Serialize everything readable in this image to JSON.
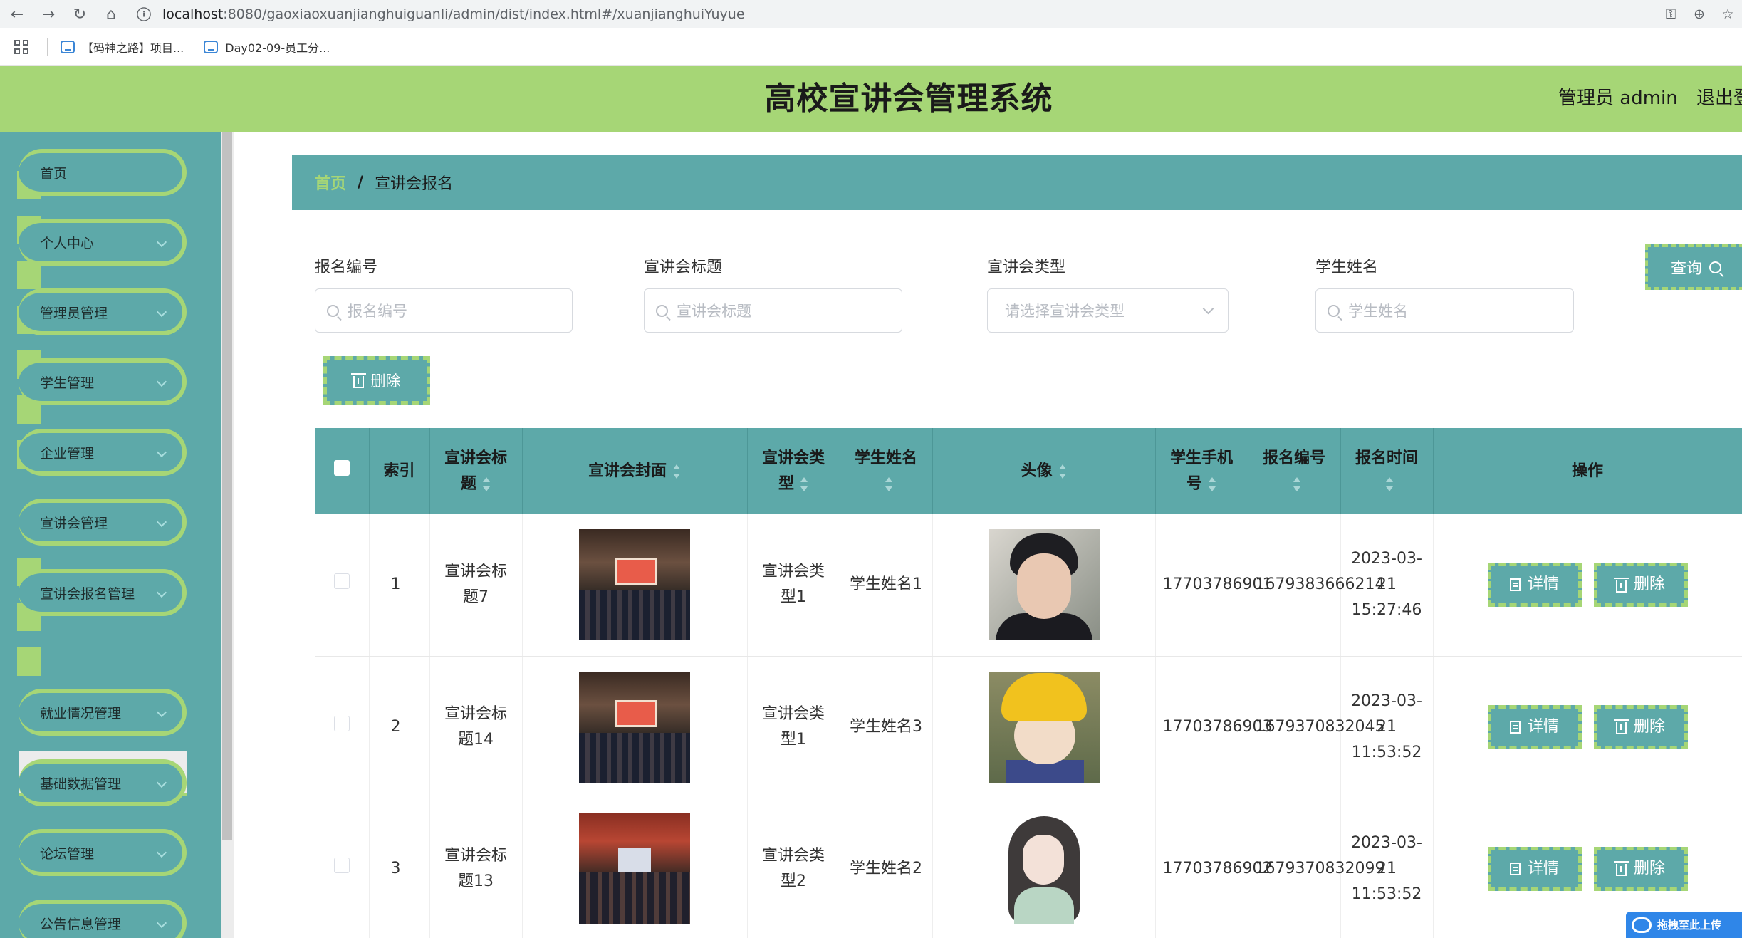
{
  "browser": {
    "url_host": "localhost",
    "url_path": ":8080/gaoxiaoxuanjianghuiguanli/admin/dist/index.html#/xuanjianghuiYuyue",
    "bookmarks": [
      "【码神之路】项目...",
      "Day02-09-员工分..."
    ]
  },
  "header": {
    "title": "高校宣讲会管理系统",
    "admin": "管理员 admin",
    "logout": "退出登录"
  },
  "sidebar": {
    "items": [
      {
        "label": "首页"
      },
      {
        "label": "个人中心"
      },
      {
        "label": "管理员管理"
      },
      {
        "label": "学生管理"
      },
      {
        "label": "企业管理"
      },
      {
        "label": "宣讲会管理"
      },
      {
        "label": "宣讲会报名管理"
      },
      {
        "label": "就业情况管理"
      },
      {
        "label": "基础数据管理"
      },
      {
        "label": "论坛管理"
      },
      {
        "label": "公告信息管理"
      }
    ],
    "active_sub": "宣讲会报名管理"
  },
  "breadcrumb": {
    "home": "首页",
    "sep": "/",
    "current": "宣讲会报名"
  },
  "filters": {
    "reg_no_label": "报名编号",
    "reg_no_placeholder": "报名编号",
    "title_label": "宣讲会标题",
    "title_placeholder": "宣讲会标题",
    "type_label": "宣讲会类型",
    "type_placeholder": "请选择宣讲会类型",
    "student_label": "学生姓名",
    "student_placeholder": "学生姓名",
    "query_button": "查询"
  },
  "toolbar": {
    "delete_button": "删除"
  },
  "table": {
    "headers": {
      "index": "索引",
      "title": "宣讲会标题",
      "cover": "宣讲会封面",
      "type": "宣讲会类型",
      "student": "学生姓名",
      "avatar": "头像",
      "phone": "学生手机号",
      "reg_no": "报名编号",
      "reg_time": "报名时间",
      "actions": "操作"
    },
    "rows": [
      {
        "index": "1",
        "title": "宣讲会标题7",
        "type": "宣讲会类型1",
        "student": "学生姓名1",
        "phone": "17703786901",
        "reg_no": "1679383666214",
        "reg_time": "2023-03-21 15:27:46"
      },
      {
        "index": "2",
        "title": "宣讲会标题14",
        "type": "宣讲会类型1",
        "student": "学生姓名3",
        "phone": "17703786903",
        "reg_no": "1679370832045",
        "reg_time": "2023-03-21 11:53:52"
      },
      {
        "index": "3",
        "title": "宣讲会标题13",
        "type": "宣讲会类型2",
        "student": "学生姓名2",
        "phone": "17703786902",
        "reg_no": "1679370832099",
        "reg_time": "2023-03-21 11:53:52"
      }
    ],
    "detail_button": "详情",
    "delete_button": "删除"
  },
  "upload_widget": "拖拽至此上传",
  "colors": {
    "teal": "#5da9a9",
    "green": "#a6d676"
  }
}
